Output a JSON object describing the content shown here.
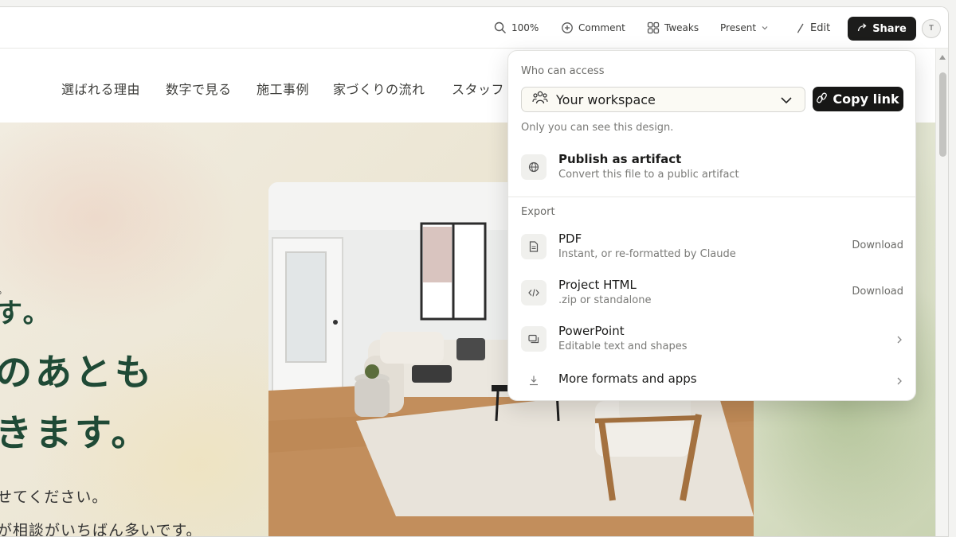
{
  "toolbar": {
    "zoom": "100%",
    "comment": "Comment",
    "tweaks": "Tweaks",
    "present": "Present",
    "edit": "Edit",
    "share": "Share",
    "avatar": "T"
  },
  "site": {
    "nav": [
      "選ばれる理由",
      "数字で見る",
      "施工事例",
      "家づくりの流れ",
      "スタッフ"
    ],
    "hero_lines": [
      "す。",
      "のあとも",
      "きます。"
    ],
    "hero_paras": [
      "せてください。",
      "が相談がいちばん多いです。"
    ],
    "hero_dot": "。"
  },
  "share_panel": {
    "who_label": "Who can access",
    "workspace": "Your workspace",
    "copy_link": "Copy link",
    "note": "Only you can see this design.",
    "publish": {
      "title": "Publish as artifact",
      "subtitle": "Convert this file to a public artifact"
    },
    "export_label": "Export",
    "exports": [
      {
        "title": "PDF",
        "subtitle": "Instant, or re-formatted by Claude",
        "action": "Download",
        "icon": "document-icon"
      },
      {
        "title": "Project HTML",
        "subtitle": ".zip or standalone",
        "action": "Download",
        "icon": "code-icon"
      },
      {
        "title": "PowerPoint",
        "subtitle": "Editable text and shapes",
        "action": "",
        "icon": "slides-icon"
      },
      {
        "title": "More formats and apps",
        "subtitle": "",
        "action": "",
        "icon": "download-icon"
      }
    ]
  }
}
